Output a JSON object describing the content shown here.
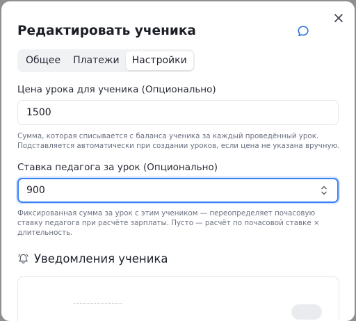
{
  "dialog": {
    "title": "Редактировать ученика"
  },
  "tabs": [
    {
      "label": "Общее",
      "active": false
    },
    {
      "label": "Платежи",
      "active": false
    },
    {
      "label": "Настройки",
      "active": true
    }
  ],
  "lesson_price": {
    "label": "Цена урока для ученика (Опционально)",
    "value": "1500",
    "hint": "Сумма, которая списывается с баланса ученика за каждый проведённый урок. Подставляется автоматически при создании уроков, если цена не указана вручную."
  },
  "teacher_rate": {
    "label": "Ставка педагога за урок (Опционально)",
    "value": "900",
    "hint": "Фиксированная сумма за урок с этим учеником — переопределяет почасовую ставку педагога при расчёте зарплаты. Пусто — расчёт по почасовой ставке × длительность."
  },
  "notifications": {
    "title": "Уведомления ученика"
  },
  "icons": {
    "chat": "chat-bubble-icon",
    "close": "close-icon",
    "bell": "bell-icon",
    "stepper": "number-stepper-icon"
  },
  "colors": {
    "accent": "#3b82f6",
    "overlay": "#8f8f8f",
    "hint_text": "#6b7180"
  }
}
